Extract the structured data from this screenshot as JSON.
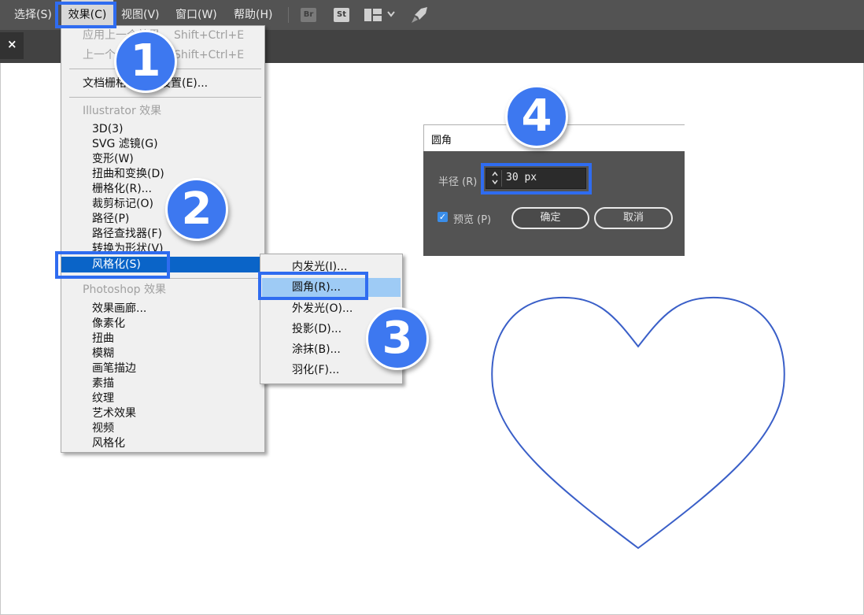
{
  "menubar": {
    "items": [
      "选择(S)",
      "效果(C)",
      "视图(V)",
      "窗口(W)",
      "帮助(H)"
    ],
    "app_badges": [
      "Br",
      "St"
    ],
    "chevron": "⌄"
  },
  "tab": {
    "close_glyph": "×"
  },
  "effect_menu": {
    "apply_last": "应用上一个效果",
    "apply_last_sc": "Shift+Ctrl+E",
    "last_effect": "上一个效果",
    "last_effect_sc": "Shift+Ctrl+E",
    "doc_raster": "文档栅格化效果设置(E)...",
    "illustrator_header": "Illustrator 效果",
    "illustrator_items": [
      "3D(3)",
      "SVG 滤镜(G)",
      "变形(W)",
      "扭曲和变换(D)",
      "栅格化(R)...",
      "裁剪标记(O)",
      "路径(P)",
      "路径查找器(F)",
      "转换为形状(V)"
    ],
    "stylize": "风格化(S)",
    "photoshop_header": "Photoshop 效果",
    "photoshop_items": [
      "效果画廊...",
      "像素化",
      "扭曲",
      "模糊",
      "画笔描边",
      "素描",
      "纹理",
      "艺术效果",
      "视频",
      "风格化"
    ]
  },
  "stylize_submenu": {
    "items": [
      "内发光(I)...",
      "圆角(R)...",
      "外发光(O)...",
      "投影(D)...",
      "涂抹(B)...",
      "羽化(F)..."
    ]
  },
  "steps": [
    "1",
    "2",
    "3",
    "4"
  ],
  "dialog": {
    "title": "圆角",
    "radius_label": "半径 (R)",
    "radius_value": "30 px",
    "preview_label": "预览 (P)",
    "preview_checked": true,
    "ok": "确定",
    "cancel": "取消"
  },
  "colors": {
    "accent": "#2f6cf0",
    "badge": "#3d78f0",
    "menu_highlight": "#0a64c8",
    "submenu_highlight": "#9ecbf5",
    "heart_stroke": "#3a5fc8"
  }
}
